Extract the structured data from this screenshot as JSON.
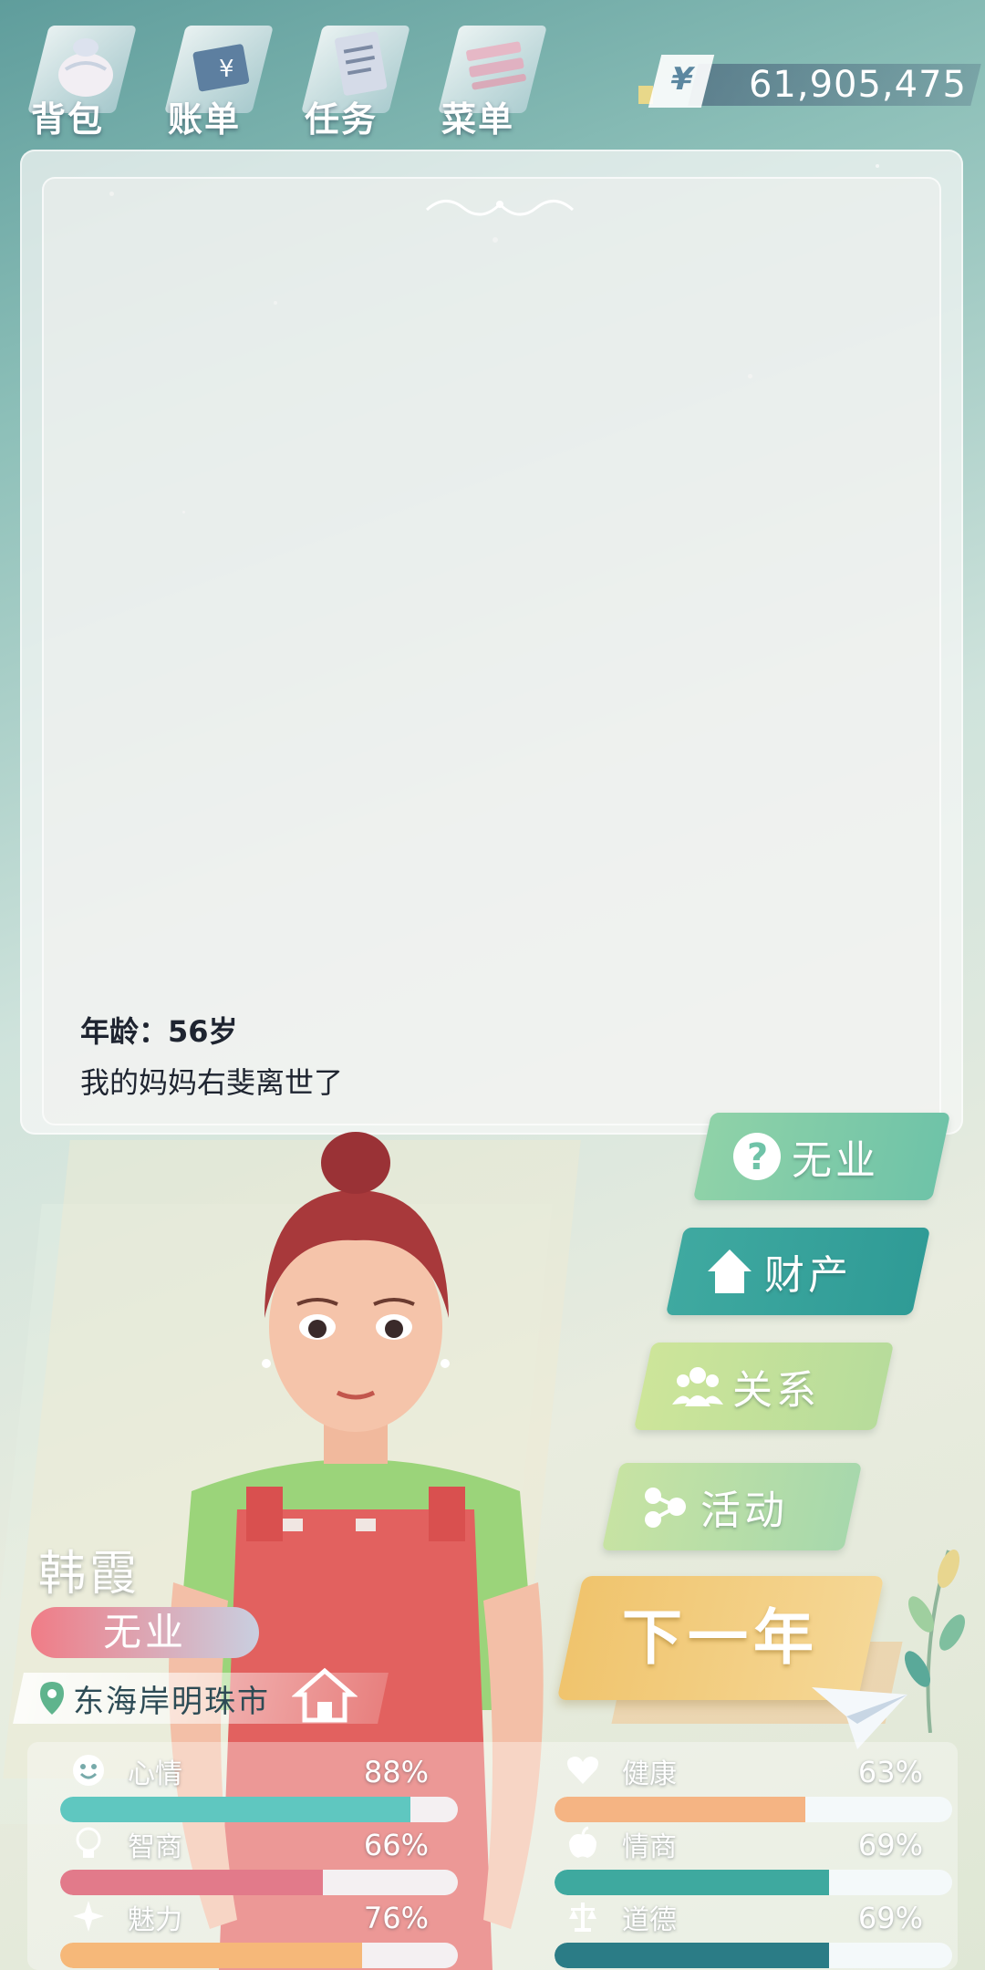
{
  "topbar": {
    "menu": [
      {
        "label": "背包",
        "icon": "bag-icon"
      },
      {
        "label": "账单",
        "icon": "bill-icon"
      },
      {
        "label": "任务",
        "icon": "task-icon"
      },
      {
        "label": "菜单",
        "icon": "menu-icon"
      }
    ],
    "money": {
      "currency_symbol": "¥",
      "value": "61,905,475"
    }
  },
  "log": {
    "age_label": "年龄：56岁",
    "entries": [
      "我的妈妈右斐离世了"
    ]
  },
  "character": {
    "name": "韩霞",
    "job": "无业",
    "location": "东海岸明珠市"
  },
  "actions": {
    "job": {
      "label": "无业",
      "icon": "question-icon"
    },
    "property": {
      "label": "财产",
      "icon": "house-icon"
    },
    "relations": {
      "label": "关系",
      "icon": "people-icon"
    },
    "activity": {
      "label": "活动",
      "icon": "nodes-icon"
    },
    "next_year": {
      "label": "下一年"
    }
  },
  "stats": [
    {
      "name": "心情",
      "percent_text": "88%",
      "value": 0.88,
      "icon": "smile-icon",
      "color": "#5fc7c0"
    },
    {
      "name": "健康",
      "percent_text": "63%",
      "value": 0.63,
      "icon": "heart-icon",
      "color": "#f5b483"
    },
    {
      "name": "智商",
      "percent_text": "66%",
      "value": 0.66,
      "icon": "bulb-icon",
      "color": "#e27a8a"
    },
    {
      "name": "情商",
      "percent_text": "69%",
      "value": 0.69,
      "icon": "apple-icon",
      "color": "#3ea99f"
    },
    {
      "name": "魅力",
      "percent_text": "76%",
      "value": 0.76,
      "icon": "sparkle-icon",
      "color": "#f6b879"
    },
    {
      "name": "道德",
      "percent_text": "69%",
      "value": 0.69,
      "icon": "scale-icon",
      "color": "#2b7c86"
    }
  ]
}
